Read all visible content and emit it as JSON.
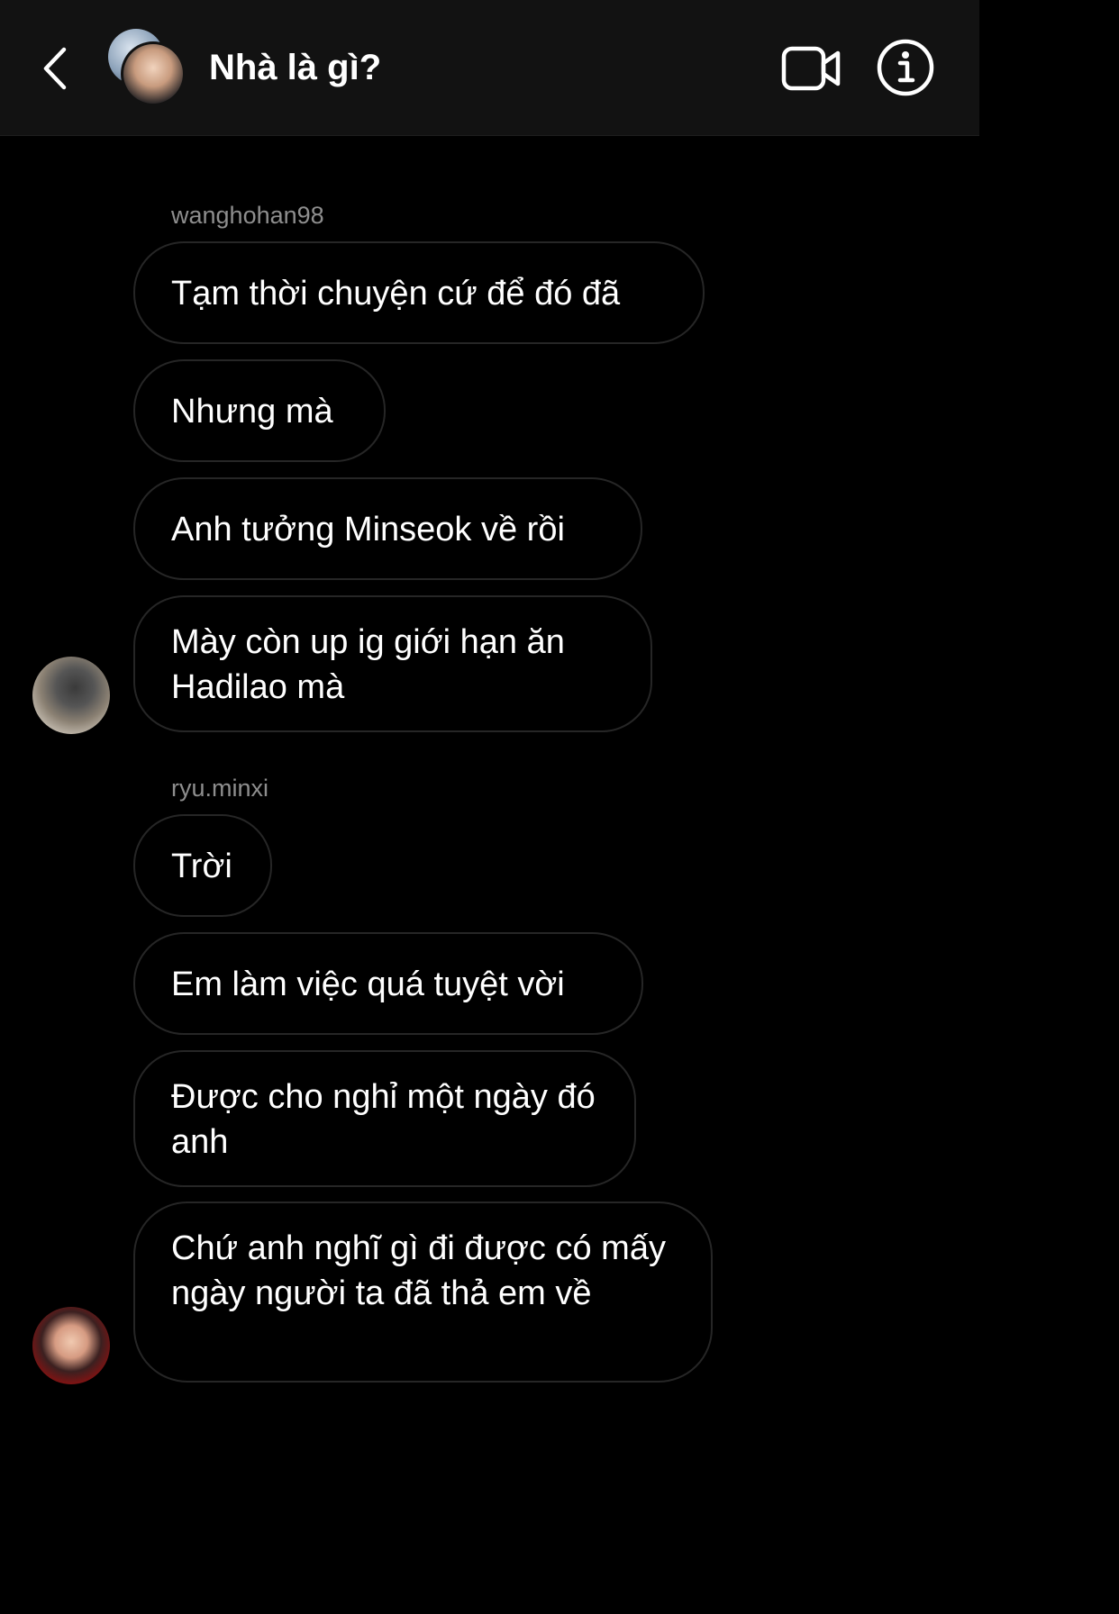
{
  "header": {
    "title": "Nhà là gì?"
  },
  "messages": [
    {
      "sender": "wanghohan98",
      "bubbles": [
        "Tạm thời chuyện cứ để đó đã",
        "Nhưng mà",
        "Anh tưởng Minseok về rồi",
        "Mày còn up ig giới hạn ăn Hadilao mà"
      ]
    },
    {
      "sender": "ryu.minxi",
      "bubbles": [
        "Trời",
        "Em làm việc quá tuyệt vời",
        "Được cho nghỉ một ngày đó anh",
        "Chứ anh nghĩ gì đi được có mấy ngày người ta đã thả em về"
      ]
    }
  ],
  "colors": {
    "background": "#000000",
    "header_bg": "#121212",
    "bubble_border": "#262626",
    "sender_name": "#8e8e8e",
    "text": "#ffffff"
  },
  "icons": [
    "chevron-left-icon",
    "video-camera-icon",
    "info-icon"
  ]
}
